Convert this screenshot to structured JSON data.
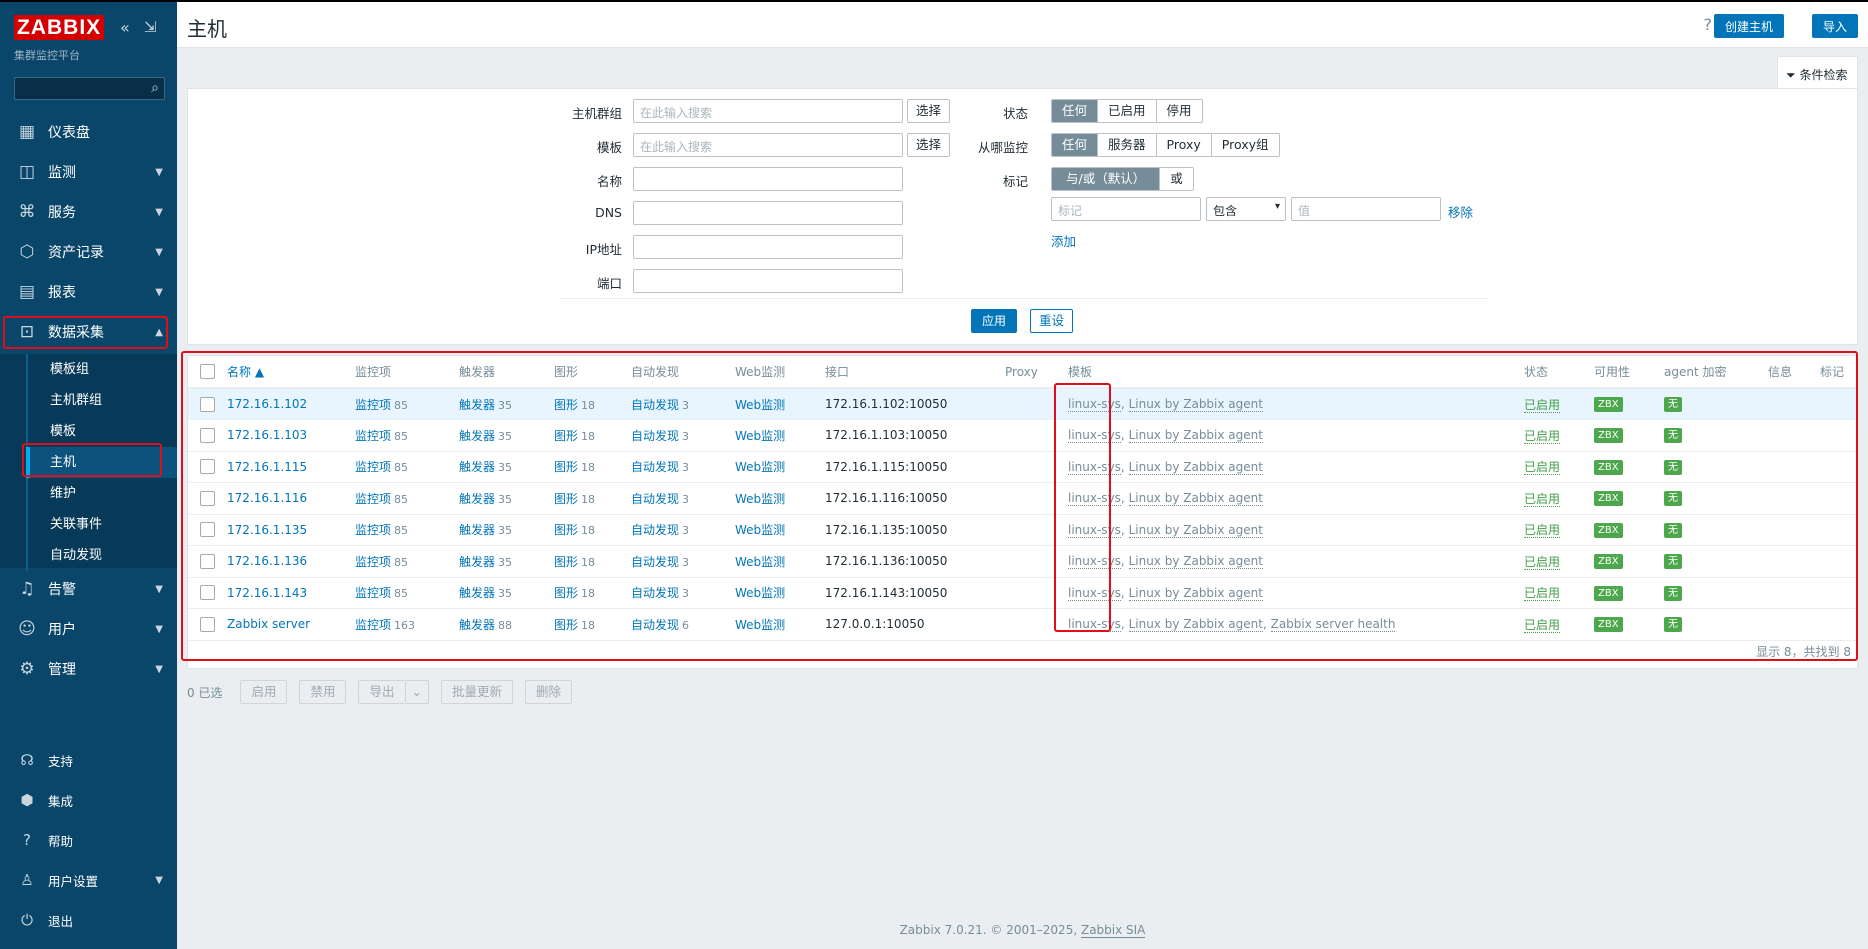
{
  "sidebar": {
    "logo": "ZABBIX",
    "subtitle": "集群监控平台",
    "menu": [
      {
        "label": "仪表盘",
        "icon": "dashboard-icon"
      },
      {
        "label": "监测",
        "icon": "monitoring-icon"
      },
      {
        "label": "服务",
        "icon": "services-icon"
      },
      {
        "label": "资产记录",
        "icon": "inventory-icon"
      },
      {
        "label": "报表",
        "icon": "reports-icon"
      },
      {
        "label": "数据采集",
        "icon": "data-collection-icon"
      }
    ],
    "submenu": [
      "模板组",
      "主机群组",
      "模板",
      "主机",
      "维护",
      "关联事件",
      "自动发现"
    ],
    "menu2": [
      {
        "label": "告警",
        "icon": "alerts-icon"
      },
      {
        "label": "用户",
        "icon": "users-icon"
      },
      {
        "label": "管理",
        "icon": "administration-icon"
      }
    ],
    "bottom": [
      {
        "label": "支持",
        "icon": "support-icon"
      },
      {
        "label": "集成",
        "icon": "integrations-icon"
      },
      {
        "label": "帮助",
        "icon": "help-icon"
      },
      {
        "label": "用户设置",
        "icon": "user-settings-icon"
      },
      {
        "label": "退出",
        "icon": "signout-icon"
      }
    ]
  },
  "header": {
    "title": "主机",
    "help": "?",
    "create_host": "创建主机",
    "import": "导入"
  },
  "filter": {
    "tab_label": "条件检索",
    "host_groups_label": "主机群组",
    "host_groups_placeholder": "在此输入搜索",
    "templates_label": "模板",
    "templates_placeholder": "在此输入搜索",
    "select_label": "选择",
    "name_label": "名称",
    "dns_label": "DNS",
    "ip_label": "IP地址",
    "port_label": "端口",
    "status_label": "状态",
    "status_options": [
      "任何",
      "已启用",
      "停用"
    ],
    "monitored_by_label": "从哪监控",
    "monitored_by_options": [
      "任何",
      "服务器",
      "Proxy",
      "Proxy组"
    ],
    "tags_label": "标记",
    "tags_options": [
      "与/或（默认）",
      "或"
    ],
    "tag_placeholder": "标记",
    "operator": "包含",
    "value_placeholder": "值",
    "remove": "移除",
    "add": "添加",
    "apply": "应用",
    "reset": "重设"
  },
  "table": {
    "headers": {
      "name": "名称 ▲",
      "items": "监控项",
      "triggers": "触发器",
      "graphs": "图形",
      "discovery": "自动发现",
      "web": "Web监测",
      "interface": "接口",
      "proxy": "Proxy",
      "templates": "模板",
      "status": "状态",
      "availability": "可用性",
      "encryption": "agent 加密",
      "info": "信息",
      "tags": "标记"
    },
    "item_label": "监控项",
    "trigger_label": "触发器",
    "graph_label": "图形",
    "discovery_label": "自动发现",
    "web_label": "Web监测",
    "rows": [
      {
        "name": "172.16.1.102",
        "items": "85",
        "triggers": "35",
        "graphs": "18",
        "discovery": "3",
        "interface": "172.16.1.102:10050",
        "templates": [
          "linux-sys",
          "Linux by Zabbix agent"
        ],
        "status": "已启用",
        "avail": "ZBX",
        "enc": "无"
      },
      {
        "name": "172.16.1.103",
        "items": "85",
        "triggers": "35",
        "graphs": "18",
        "discovery": "3",
        "interface": "172.16.1.103:10050",
        "templates": [
          "linux-sys",
          "Linux by Zabbix agent"
        ],
        "status": "已启用",
        "avail": "ZBX",
        "enc": "无"
      },
      {
        "name": "172.16.1.115",
        "items": "85",
        "triggers": "35",
        "graphs": "18",
        "discovery": "3",
        "interface": "172.16.1.115:10050",
        "templates": [
          "linux-sys",
          "Linux by Zabbix agent"
        ],
        "status": "已启用",
        "avail": "ZBX",
        "enc": "无"
      },
      {
        "name": "172.16.1.116",
        "items": "85",
        "triggers": "35",
        "graphs": "18",
        "discovery": "3",
        "interface": "172.16.1.116:10050",
        "templates": [
          "linux-sys",
          "Linux by Zabbix agent"
        ],
        "status": "已启用",
        "avail": "ZBX",
        "enc": "无"
      },
      {
        "name": "172.16.1.135",
        "items": "85",
        "triggers": "35",
        "graphs": "18",
        "discovery": "3",
        "interface": "172.16.1.135:10050",
        "templates": [
          "linux-sys",
          "Linux by Zabbix agent"
        ],
        "status": "已启用",
        "avail": "ZBX",
        "enc": "无"
      },
      {
        "name": "172.16.1.136",
        "items": "85",
        "triggers": "35",
        "graphs": "18",
        "discovery": "3",
        "interface": "172.16.1.136:10050",
        "templates": [
          "linux-sys",
          "Linux by Zabbix agent"
        ],
        "status": "已启用",
        "avail": "ZBX",
        "enc": "无"
      },
      {
        "name": "172.16.1.143",
        "items": "85",
        "triggers": "35",
        "graphs": "18",
        "discovery": "3",
        "interface": "172.16.1.143:10050",
        "templates": [
          "linux-sys",
          "Linux by Zabbix agent"
        ],
        "status": "已启用",
        "avail": "ZBX",
        "enc": "无"
      },
      {
        "name": "Zabbix server",
        "items": "163",
        "triggers": "88",
        "graphs": "18",
        "discovery": "6",
        "interface": "127.0.0.1:10050",
        "templates": [
          "linux-sys",
          "Linux by Zabbix agent",
          "Zabbix server health"
        ],
        "status": "已启用",
        "avail": "ZBX",
        "enc": "无"
      }
    ],
    "footer_count": "显示 8，共找到 8"
  },
  "actions": {
    "selected": "0 已选",
    "enable": "启用",
    "disable": "禁用",
    "export": "导出",
    "mass_update": "批量更新",
    "delete": "删除"
  },
  "footer": {
    "text": "Zabbix 7.0.21. © 2001–2025, ",
    "link": "Zabbix SIA"
  },
  "colors": {
    "sidebar": "#0a466a",
    "accent": "#0275b8",
    "enabled": "#429e47",
    "highlight": "#e00d1c"
  }
}
